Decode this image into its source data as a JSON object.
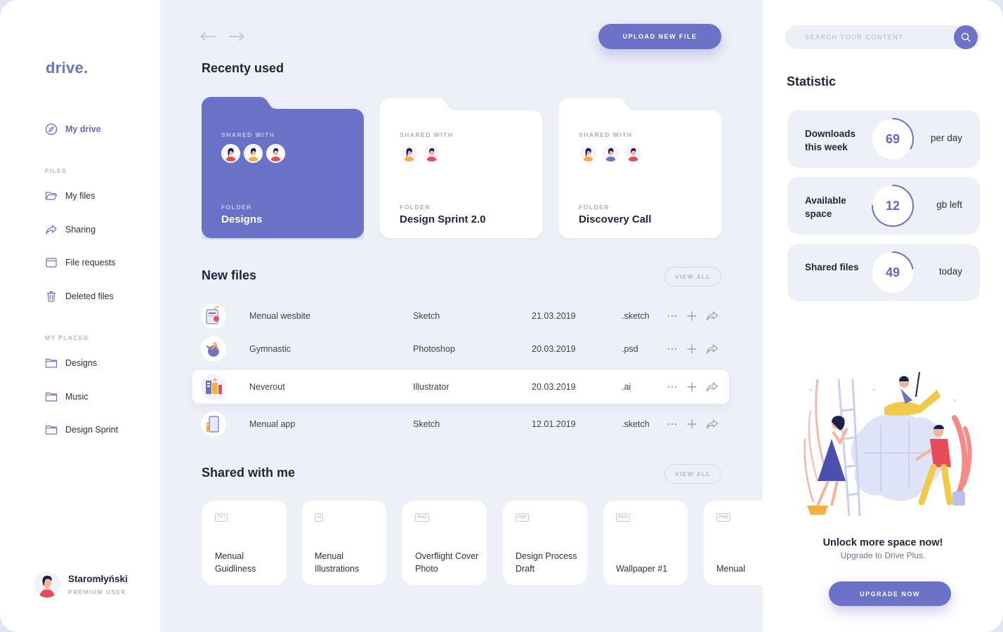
{
  "brand": {
    "logo": "drive.",
    "accent": "#6b72c8"
  },
  "sidebar": {
    "primary": {
      "label": "My drive",
      "icon": "compass-icon"
    },
    "files_section": "FILES",
    "files": [
      {
        "label": "My files",
        "icon": "folder-open-icon"
      },
      {
        "label": "Sharing",
        "icon": "share-arrow-icon"
      },
      {
        "label": "File requests",
        "icon": "tray-icon"
      },
      {
        "label": "Deleted files",
        "icon": "trash-icon"
      }
    ],
    "places_section": "MY PLACES",
    "places": [
      {
        "label": "Designs",
        "icon": "folder-icon"
      },
      {
        "label": "Music",
        "icon": "folder-icon"
      },
      {
        "label": "Design Sprint",
        "icon": "folder-icon"
      }
    ],
    "user": {
      "name": "Staromłyński",
      "role": "PREMIUM USER"
    }
  },
  "main": {
    "upload_label": "UPLOAD NEW FILE",
    "recent_title": "Recenty used",
    "folders": [
      {
        "shared_label": "SHARED WITH",
        "folder_label": "FOLDER",
        "name": "Designs",
        "avatars": 3,
        "active": true
      },
      {
        "shared_label": "SHARED WITH",
        "folder_label": "FOLDER",
        "name": "Design Sprint 2.0",
        "avatars": 2,
        "active": false
      },
      {
        "shared_label": "SHARED WITH",
        "folder_label": "FOLDER",
        "name": "Discovery Call",
        "avatars": 3,
        "active": false
      }
    ],
    "new_files_title": "New files",
    "view_all_label": "VIEW ALL",
    "files": [
      {
        "name": "Menual wesbite",
        "app": "Sketch",
        "date": "21.03.2019",
        "ext": ".sketch"
      },
      {
        "name": "Gymnastic",
        "app": "Photoshop",
        "date": "20.03.2019",
        "ext": ".psd"
      },
      {
        "name": "Neverout",
        "app": "Illustrator",
        "date": "20.03.2019",
        "ext": ".ai"
      },
      {
        "name": "Menual app",
        "app": "Sketch",
        "date": "12.01.2019",
        "ext": ".sketch"
      }
    ],
    "shared_title": "Shared with me",
    "shared": [
      {
        "type": "TXT",
        "title": "Menual Guidliness"
      },
      {
        "type": "AI",
        "title": "Menual Illustrations"
      },
      {
        "type": "PNG",
        "title": "Overflight Cover Photo"
      },
      {
        "type": "PDF",
        "title": "Design Process Draft"
      },
      {
        "type": "PNG",
        "title": "Wallpaper #1"
      },
      {
        "type": "PNG",
        "title": "Menual"
      }
    ]
  },
  "right": {
    "search_placeholder": "SEARCH YOUR CONTENT",
    "statistic_title": "Statistic",
    "stats": [
      {
        "label": "Downloads this week",
        "value": "69",
        "unit": "per day",
        "fill": 0.33
      },
      {
        "label": "Available space",
        "value": "12",
        "unit": "gb left",
        "fill": 0.75
      },
      {
        "label": "Shared files",
        "value": "49",
        "unit": "today",
        "fill": 0.22
      }
    ],
    "promo_title": "Unlock more space now!",
    "promo_sub": "Upgrade to Drive Plus.",
    "upgrade_label": "UPGRADE NOW"
  }
}
